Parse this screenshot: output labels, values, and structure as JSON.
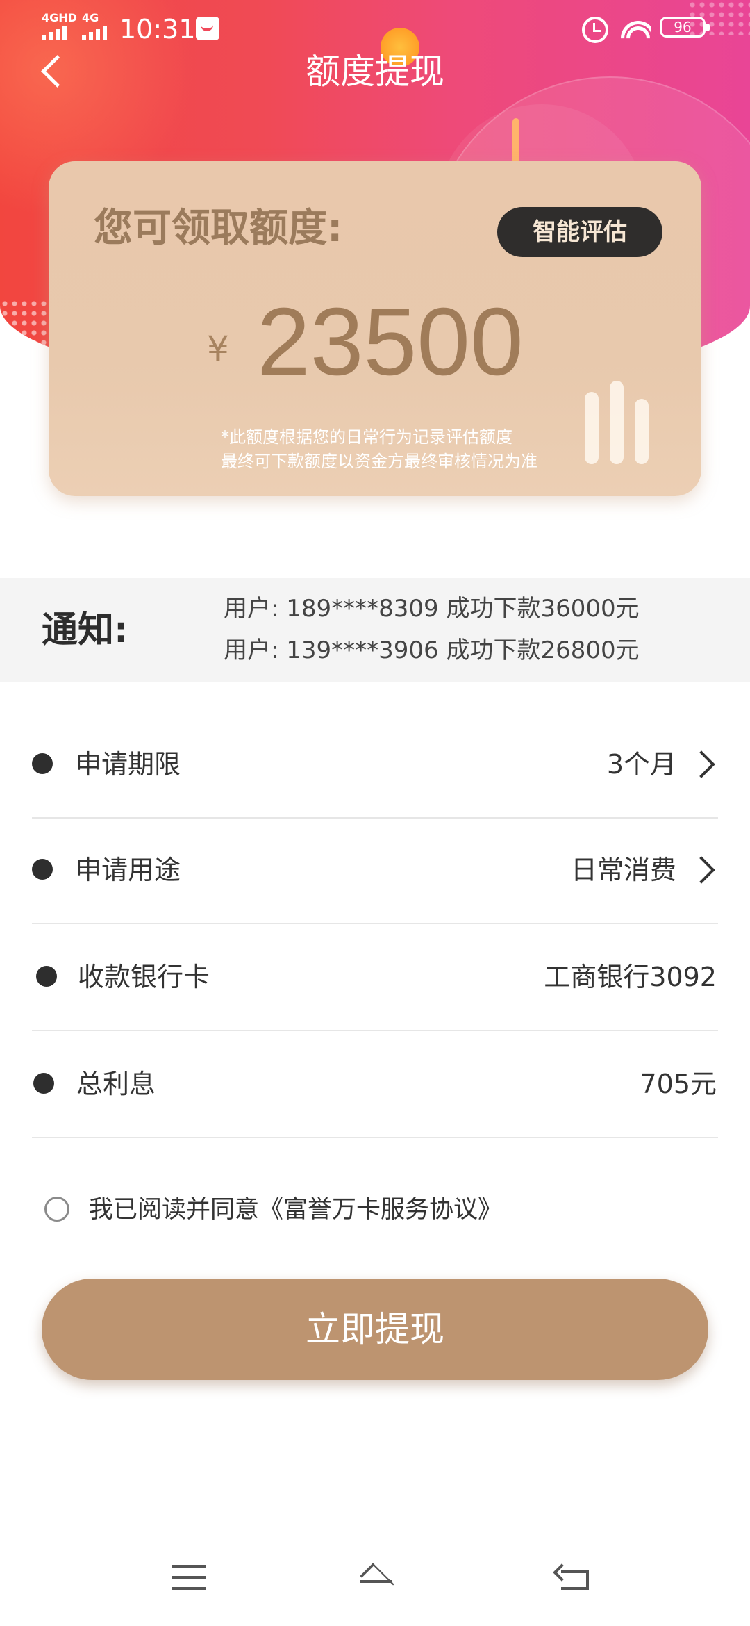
{
  "status_bar": {
    "signal_1": "4GHD",
    "signal_2": "4G",
    "time": "10:31",
    "battery": "96"
  },
  "header": {
    "title": "额度提现",
    "back_icon": "back-arrow-icon"
  },
  "quota_card": {
    "label": "您可领取额度:",
    "eval_button": "智能评估",
    "currency": "¥",
    "amount": "23500",
    "note_line1": "*此额度根据您的日常行为记录评估额度",
    "note_line2": "最终可下款额度以资金方最终审核情况为准"
  },
  "notice": {
    "title": "通知:",
    "items": [
      "用户: 189****8309   成功下款36000元",
      "用户: 139****3906   成功下款26800元"
    ]
  },
  "form": {
    "rows": [
      {
        "label": "申请期限",
        "value": "3个月"
      },
      {
        "label": "申请用途",
        "value": "日常消费"
      },
      {
        "label": "收款银行卡",
        "value": "工商银行3092"
      },
      {
        "label": "总利息",
        "value": "705元"
      }
    ]
  },
  "agreement": {
    "text": "我已阅读并同意《富誉万卡服务协议》"
  },
  "cta": {
    "label": "立即提现"
  },
  "colors": {
    "hero_gradient_start": "#f2463f",
    "hero_gradient_end": "#e94596",
    "card_bg": "#e8c9ad",
    "amount_text": "#a07c59",
    "cta_bg": "#bd9470",
    "eval_button_bg": "#2f2d2c"
  }
}
